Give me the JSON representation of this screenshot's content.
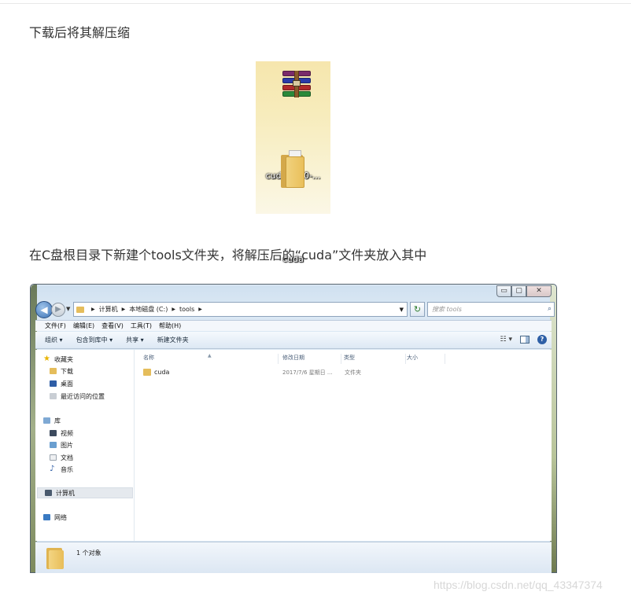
{
  "article": {
    "para1": "下载后将其解压缩",
    "para2": "在C盘根目录下新建个tools文件夹，将解压后的“cuda”文件夹放入其中"
  },
  "desktop": {
    "archive_label": "cudnn-8.0-...",
    "folder_label": "cuda"
  },
  "explorer": {
    "window_controls": {
      "minimize": "▭",
      "maximize": "▢",
      "close": "✕"
    },
    "address": {
      "back": "◀",
      "forward": "▶",
      "path": [
        "计算机",
        "本地磁盘 (C:)",
        "tools"
      ]
    },
    "search_placeholder": "搜索 tools",
    "menu": [
      "文件(F)",
      "编辑(E)",
      "查看(V)",
      "工具(T)",
      "帮助(H)"
    ],
    "toolbar": [
      "组织 ▾",
      "包含到库中 ▾",
      "共享 ▾",
      "新建文件夹"
    ],
    "nav": {
      "favorites": "收藏夹",
      "downloads": "下载",
      "desktop": "桌面",
      "recent": "最近访问的位置",
      "libraries": "库",
      "videos": "视频",
      "pictures": "图片",
      "documents": "文档",
      "music": "音乐",
      "computer": "计算机",
      "network": "网络"
    },
    "columns": [
      "名称",
      "修改日期",
      "类型",
      "大小"
    ],
    "rows": [
      {
        "name": "cuda",
        "modified": "2017/7/6 星期日 ...",
        "type": "文件夹",
        "size": ""
      }
    ],
    "status": "1 个对象"
  },
  "watermark": "https://blog.csdn.net/qq_43347374",
  "colors": {
    "folder": "#e5bd5b",
    "window_frame": "#dbe8f4",
    "selection": "#e5e9ee"
  }
}
